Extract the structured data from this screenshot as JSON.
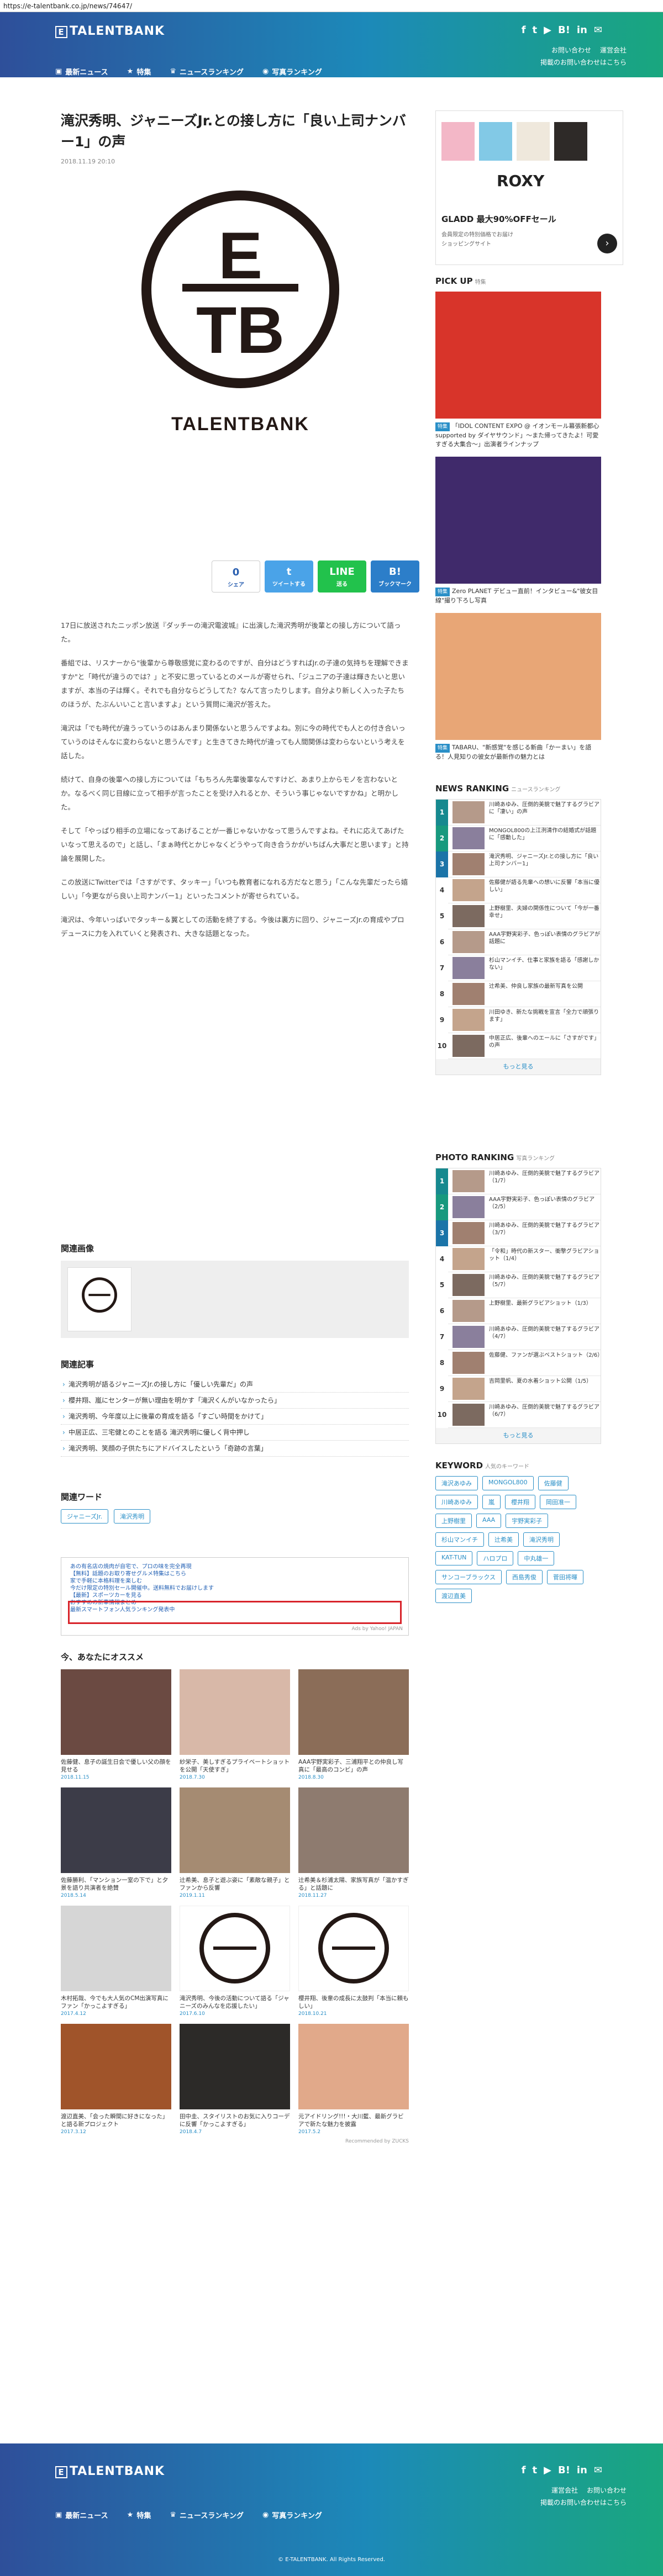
{
  "url": "https://e-talentbank.co.jp/news/74647/",
  "header": {
    "brand": "TALENTBANK",
    "brand_mark": "E",
    "socials": [
      {
        "icon": "facebook-icon",
        "glyph": "f"
      },
      {
        "icon": "twitter-icon",
        "glyph": "t"
      },
      {
        "icon": "youtube-icon",
        "glyph": "▶"
      },
      {
        "icon": "hatena-icon",
        "glyph": "B!"
      },
      {
        "icon": "linkedin-icon",
        "glyph": "in"
      },
      {
        "icon": "line-icon",
        "glyph": "✉"
      }
    ],
    "links_top": [
      "お問い合わせ",
      "運営会社"
    ],
    "links_bottom": "掲載のお問い合わせはこちら",
    "nav": [
      "最新ニュース",
      "特集",
      "ニュースランキング",
      "写真ランキング"
    ]
  },
  "article": {
    "title": "滝沢秀明、ジャニーズJr.との接し方に「良い上司ナンバー1」の声",
    "date": "2018.11.19 20:10",
    "logo_text": "TALENTBANK",
    "logo_letters": [
      "E",
      "TB"
    ],
    "share": [
      {
        "label": "シェア",
        "count": "0",
        "color": "#ffffff",
        "icon": "facebook-icon"
      },
      {
        "label": "ツイートする",
        "count": "t",
        "color": "#4aa3e8",
        "icon": "twitter-icon"
      },
      {
        "label": "送る",
        "count": "LINE",
        "color": "#22c24c",
        "icon": "line-icon"
      },
      {
        "label": "ブックマーク",
        "count": "B!",
        "color": "#2c7ec9",
        "icon": "hatena-icon"
      }
    ],
    "paragraphs": [
      "17日に放送されたニッポン放送『ダッチーの滝沢電波城』に出演した滝沢秀明が後輩との接し方について語った。",
      "番組では、リスナーから\"後輩から尊敬感覚に変わるのですが、自分はどうすればJr.の子達の気持ちを理解できますか\"と「時代が違うのでは？」と不安に思っているとのメールが寄せられ、「ジュニアの子達は輝きたいと思いますが、本当の子は輝く。それでも自分ならどうしてた？なんて言ったりします。自分より新しく入った子たちのほうが、たぶんいいこと言いますよ」という質問に滝沢が答えた。",
      "滝沢は「でも時代が違うっていうのはあんまり関係ないと思うんですよね。別に今の時代でも人との付き合いっていうのはそんなに変わらないと思うんです」と生きてきた時代が違っても人間関係は変わらないという考えを話した。",
      "続けて、自身の後輩への接し方については「もちろん先輩後輩なんですけど、あまり上からモノを言わないとか。なるべく同じ目線に立って相手が言ったことを受け入れるとか、そういう事じゃないですかね」と明かした。",
      "そして「やっぱり相手の立場になってあげることが一番じゃないかなって思うんですよね。それに応えてあげたいなって思えるので」と話し、「まぁ時代とかじゃなくどうやって向き合うかがいちばん大事だと思います」と持論を展開した。",
      "この放送にTwitterでは「さすがです、タッキー」「いつも教育者になれる方だなと思う」「こんな先輩だったら嬉しい」「今更ながら良い上司ナンバー1」といったコメントが寄せられている。",
      "滝沢は、今年いっぱいでタッキー＆翼としての活動を終了する。今後は裏方に回り、ジャニーズJr.の育成やプロデュースに力を入れていくと発表され、大きな話題となった。"
    ]
  },
  "related_images": {
    "heading": "関連画像"
  },
  "related_articles": {
    "heading": "関連記事",
    "items": [
      "滝沢秀明が語るジャニーズJr.の接し方に「優しい先輩だ」の声",
      "櫻井翔、嵐にセンターが無い理由を明かす「滝沢くんがいなかったら」",
      "滝沢秀明、今年度以上に後輩の育成を語る「すごい時間をかけて」",
      "中居正広、三宅健とのことを語る 滝沢秀明に優しく背中押し",
      "滝沢秀明、笑顔の子供たちにアドバイスしたという「奇跡の言葉」"
    ]
  },
  "related_words": {
    "heading": "関連ワード",
    "tags": [
      "ジャニーズJr.",
      "滝沢秀明"
    ]
  },
  "ad": {
    "lines": [
      "あの有名店の焼肉が自宅で、プロの味を完全再現",
      "【無料】話題のお取り寄せグルメ特集はこちら",
      "家で手軽に本格料理を楽しむ",
      "今だけ限定の特別セール開催中。送料無料でお届けします",
      "【最新】スポーツカーを見る",
      "おすすめの新車情報まとめ",
      "最新スマートフォン人気ランキング発表中"
    ],
    "footer": "Ads by Yahoo! JAPAN"
  },
  "recommend": {
    "heading": "今、あなたにオススメ",
    "powered": "Recommended by ZUCKS",
    "cards": [
      {
        "caption": "佐藤健、息子の誕生日会で優しい父の顔を見せる",
        "date": "2018.11.15",
        "color": "#6b4a42"
      },
      {
        "caption": "紗栄子、美しすぎるプライベートショットを公開「天使すぎ」",
        "date": "2018.7.30",
        "color": "#d8b8a8"
      },
      {
        "caption": "AAA宇野実彩子、三浦翔平との仲良し写真に「最高のコンビ」の声",
        "date": "2018.8.30",
        "color": "#8b6d58"
      },
      {
        "caption": "佐藤勝利、「マンション一室の下で」と夕景を語り共演者を絶賛",
        "date": "2018.5.14",
        "color": "#3c3c48"
      },
      {
        "caption": "辻希美、息子と遊ぶ姿に「素敵な親子」とファンから反響",
        "date": "2019.1.11",
        "color": "#a58b72"
      },
      {
        "caption": "辻希美＆杉浦太陽、家族写真が「温かすぎる」と話題に",
        "date": "2018.11.27",
        "color": "#8e7b6f"
      },
      {
        "caption": "木村拓哉、今でも大人気のCM出演写真にファン「かっこよすぎる」",
        "date": "2017.4.12",
        "color": "#d6d6d6"
      },
      {
        "caption": "滝沢秀明、今後の活動について語る「ジャニーズのみんなを応援したい」",
        "date": "2017.6.10",
        "color": "#ffffff"
      },
      {
        "caption": "櫻井翔、後輩の成長に太鼓判「本当に頼もしい」",
        "date": "2018.10.21",
        "color": "#ffffff"
      },
      {
        "caption": "渡辺直美、「会った瞬間に好きになった」と語る新プロジェクト",
        "date": "2017.3.12",
        "color": "#a0542a"
      },
      {
        "caption": "田中圭、スタイリストのお気に入りコーデに反響「かっこよすぎる」",
        "date": "2018.4.7",
        "color": "#2c2a28"
      },
      {
        "caption": "元アイドリング!!!・大川藍、最新グラビアで新たな魅力を披露",
        "date": "2017.5.2",
        "color": "#e1a98a"
      }
    ]
  },
  "sidebar": {
    "ad": {
      "brand": "ROXY",
      "headline": "GLADD 最大90%OFFセール",
      "sub": "会員限定の特別価格でお届け",
      "footer": "ショッピングサイト"
    },
    "pickup": {
      "heading": "PICK UP",
      "sub": "特集",
      "items": [
        {
          "badge": "特集",
          "caption": "「IDOL CONTENT EXPO @ イオンモール幕張新都心 supported by ダイヤサウンド」〜また帰ってきたよ！可愛すぎる大集合〜」出演者ラインナップ",
          "color": "#d8342a"
        },
        {
          "badge": "特集",
          "caption": "Zero PLANET デビュー直前！インタビュー&\"彼女目線\"撮り下ろし写真",
          "color": "#402a6b"
        },
        {
          "badge": "特集",
          "caption": "TABARU、\"新感覚\"を感じる新曲「かーまい」を語る！人見知りの彼女が最新作の魅力とは",
          "color": "#e8a676"
        }
      ]
    },
    "news_ranking": {
      "heading": "NEWS RANKING",
      "sub": "ニュースランキング",
      "items": [
        "川崎あゆみ、圧倒的美貌で魅了するグラビアに「凄い」の声",
        "MONGOL800の上江洌清作の結婚式が話題に「感動した」",
        "滝沢秀明、ジャニーズJr.との接し方に「良い上司ナンバー1」",
        "佐藤健が語る先輩への想いに反響「本当に優しい」",
        "上野樹里、夫婦の関係性について「今が一番幸せ」",
        "AAA宇野実彩子、色っぽい表情のグラビアが話題に",
        "杉山マンイチ、仕事と家族を語る「感謝しかない」",
        "辻希美、仲良し家族の最新写真を公開",
        "川田ゆき、新たな挑戦を宣言「全力で頑張ります」",
        "中居正広、後輩へのエールに「さすがです」の声"
      ],
      "more": "もっと見る"
    },
    "photo_ranking": {
      "heading": "PHOTO RANKING",
      "sub": "写真ランキング",
      "items": [
        "川崎あゆみ、圧倒的美貌で魅了するグラビア（1/7）",
        "AAA宇野実彩子、色っぽい表情のグラビア（2/5）",
        "川崎あゆみ、圧倒的美貌で魅了するグラビア（3/7）",
        "「令和」時代の新スター、衝撃グラビアショット（1/4）",
        "川崎あゆみ、圧倒的美貌で魅了するグラビア（5/7）",
        "上野樹里、最新グラビアショット（1/3）",
        "川崎あゆみ、圧倒的美貌で魅了するグラビア（4/7）",
        "佐藤健、ファンが選ぶベストショット（2/6）",
        "吉岡里帆、夏の水着ショット公開（1/5）",
        "川崎あゆみ、圧倒的美貌で魅了するグラビア（6/7）"
      ],
      "more": "もっと見る"
    },
    "keywords": {
      "heading": "KEYWORD",
      "sub": "人気のキーワード",
      "tags": [
        "滝沢あゆみ",
        "MONGOL800",
        "佐藤健",
        "川崎あゆみ",
        "嵐",
        "櫻井翔",
        "岡田准一",
        "上野樹里",
        "AAA",
        "宇野実彩子",
        "杉山マンイチ",
        "辻希美",
        "滝沢秀明",
        "KAT-TUN",
        "ハロプロ",
        "中丸雄一",
        "サンコーブラックス",
        "西島秀俊",
        "菅田将暉",
        "渡辺直美"
      ]
    }
  },
  "footer": {
    "links": [
      "運営会社",
      "お問い合わせ"
    ],
    "contact": "掲載のお問い合わせはこちら",
    "copyright": "© E-TALENTBANK. All Rights Reserved."
  }
}
